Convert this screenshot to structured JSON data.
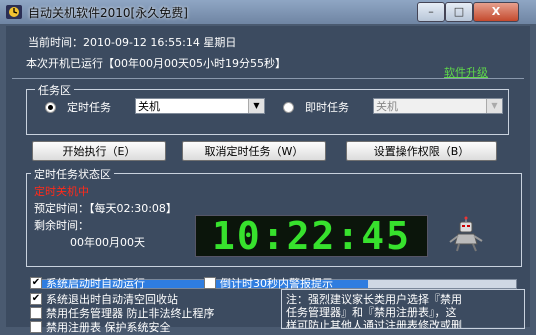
{
  "window": {
    "title": "自动关机软件2010[永久免费]",
    "min_label": "–",
    "max_label": "□",
    "close_label": "X"
  },
  "header": {
    "current_time": "当前时间：2010-09-12 16:55:14 星期日",
    "uptime": "本次开机已运行【00年00月00天05小时19分55秒】",
    "upgrade_link": "软件升级"
  },
  "task_area": {
    "legend": "任务区",
    "timed_task_label": "定时任务",
    "timed_task_value": "关机",
    "instant_task_label": "即时任务",
    "instant_task_value": "关机",
    "start_button": "开始执行（E）",
    "cancel_button": "取消定时任务（W）",
    "permission_button": "设置操作权限（B）"
  },
  "status_area": {
    "legend": "定时任务状态区",
    "status_text": "定时关机中",
    "scheduled_time": "预定时间：【每天02:30:08】",
    "remaining_label": "剩余时间：",
    "remaining_date": "00年00月00天",
    "countdown": "10:22:45",
    "progress_fraction": 0.69
  },
  "options": {
    "autostart": "系统启动时自动运行",
    "warn_30s": "倒计时30秒内警报提示",
    "clear_recycle": "系统退出时自动清空回收站",
    "disable_taskmgr": "禁用任务管理器 防止非法终止程序",
    "disable_regedit": "禁用注册表 保护系统安全"
  },
  "note": {
    "line1": "注：强烈建议家长类用户选择『禁用",
    "line2": "任务管理器』和『禁用注册表』，这",
    "line3": "样可防止其他人通过注册表修改或删"
  },
  "colors": {
    "accent_green": "#37e12d",
    "status_red": "#ff2a1a",
    "upgrade_green": "#5ed84a"
  },
  "icons": [
    "app-icon",
    "robot-icon",
    "chevron-down-icon"
  ]
}
